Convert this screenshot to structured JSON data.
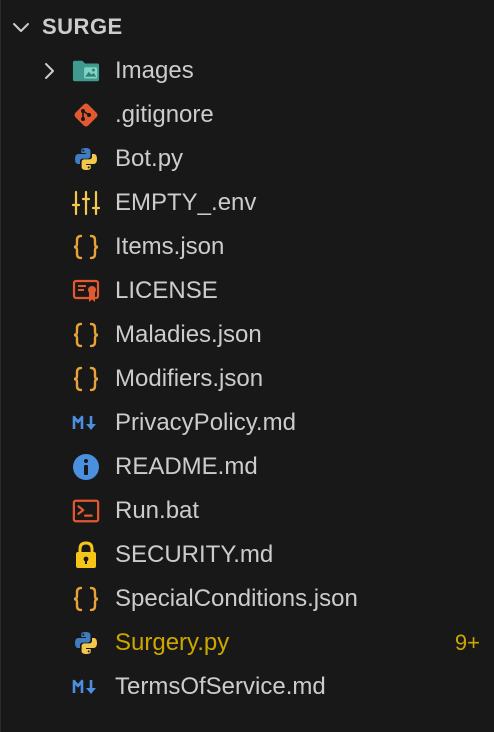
{
  "explorer": {
    "section_title": "SURGE",
    "items": [
      {
        "label": "Images",
        "icon": "folder-images-icon"
      },
      {
        "label": ".gitignore",
        "icon": "git-icon"
      },
      {
        "label": "Bot.py",
        "icon": "python-icon"
      },
      {
        "label": "EMPTY_.env",
        "icon": "env-settings-icon"
      },
      {
        "label": "Items.json",
        "icon": "json-icon"
      },
      {
        "label": "LICENSE",
        "icon": "license-icon"
      },
      {
        "label": "Maladies.json",
        "icon": "json-icon"
      },
      {
        "label": "Modifiers.json",
        "icon": "json-icon"
      },
      {
        "label": "PrivacyPolicy.md",
        "icon": "markdown-icon"
      },
      {
        "label": "README.md",
        "icon": "info-icon"
      },
      {
        "label": "Run.bat",
        "icon": "terminal-icon"
      },
      {
        "label": "SECURITY.md",
        "icon": "lock-icon"
      },
      {
        "label": "SpecialConditions.json",
        "icon": "json-icon"
      },
      {
        "label": "Surgery.py",
        "icon": "python-icon",
        "badge": "9+"
      },
      {
        "label": "TermsOfService.md",
        "icon": "markdown-icon"
      }
    ]
  },
  "colors": {
    "background": "#181818",
    "text": "#cccccc",
    "warning": "#cca700",
    "json": "#e8a23a",
    "python_blue": "#3f7cc1",
    "python_yellow": "#f2c94c",
    "git": "#e2582f",
    "markdown": "#4b8fe0",
    "info": "#4b8fe0",
    "license": "#e2582f",
    "terminal": "#e2582f",
    "lock": "#f5c518",
    "folder": "#4db6ac"
  }
}
